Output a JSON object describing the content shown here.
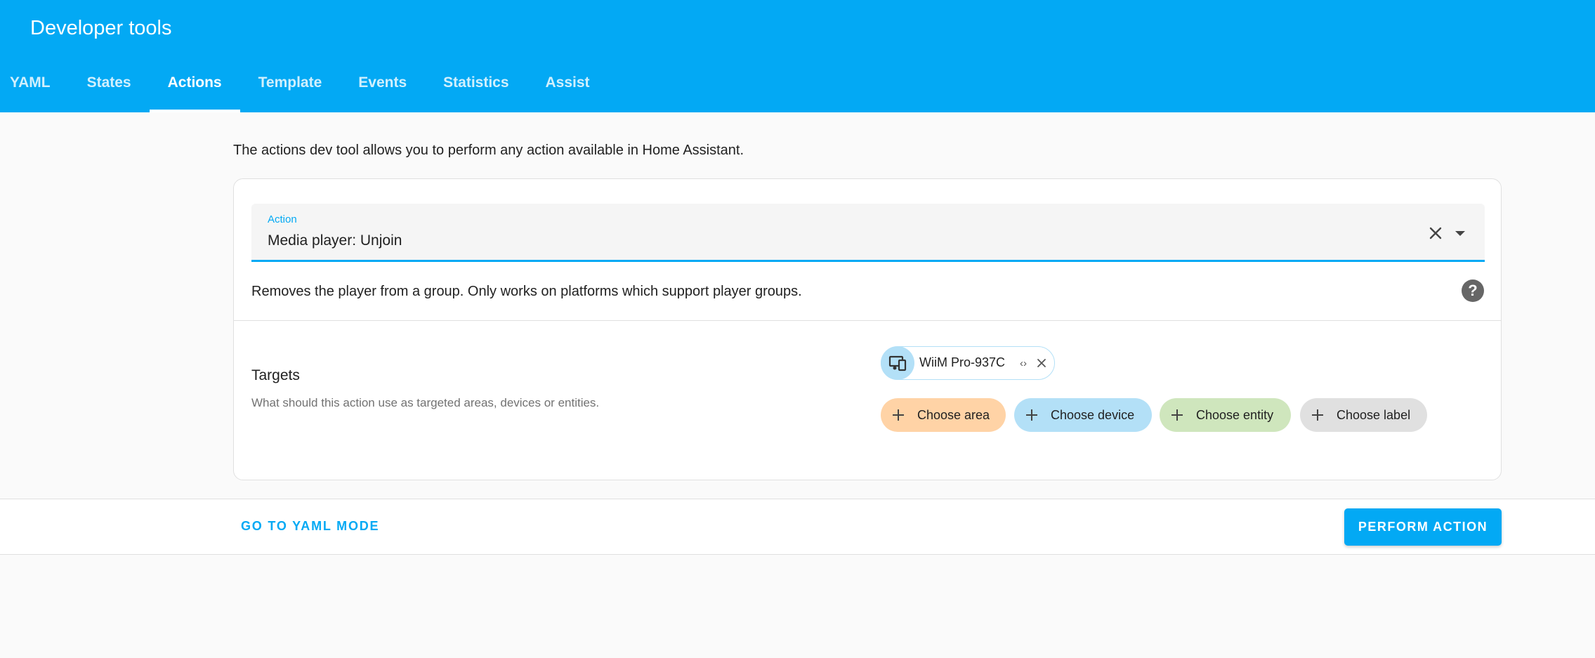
{
  "header": {
    "title": "Developer tools",
    "tabs": [
      {
        "label": "YAML"
      },
      {
        "label": "States"
      },
      {
        "label": "Actions"
      },
      {
        "label": "Template"
      },
      {
        "label": "Events"
      },
      {
        "label": "Statistics"
      },
      {
        "label": "Assist"
      }
    ],
    "active_tab": "Actions"
  },
  "main": {
    "intro": "The actions dev tool allows you to perform any action available in Home Assistant.",
    "action_select": {
      "label": "Action",
      "value": "Media player: Unjoin"
    },
    "description": "Removes the player from a group. Only works on platforms which support player groups.",
    "targets": {
      "title": "Targets",
      "subtitle": "What should this action use as targeted areas, devices or entities.",
      "selected": [
        {
          "label": "WiiM Pro-937C",
          "icon": "device-icon"
        }
      ],
      "add_chips": [
        {
          "label": "Choose area",
          "color": "#ffd3a6"
        },
        {
          "label": "Choose device",
          "color": "#b3e0f7"
        },
        {
          "label": "Choose entity",
          "color": "#cfe6bd"
        },
        {
          "label": "Choose label",
          "color": "#e0e0e0"
        }
      ]
    }
  },
  "footer": {
    "yaml_link": "GO TO YAML MODE",
    "perform_button": "PERFORM ACTION"
  },
  "colors": {
    "primary": "#03a9f4",
    "background": "#fafafa"
  }
}
